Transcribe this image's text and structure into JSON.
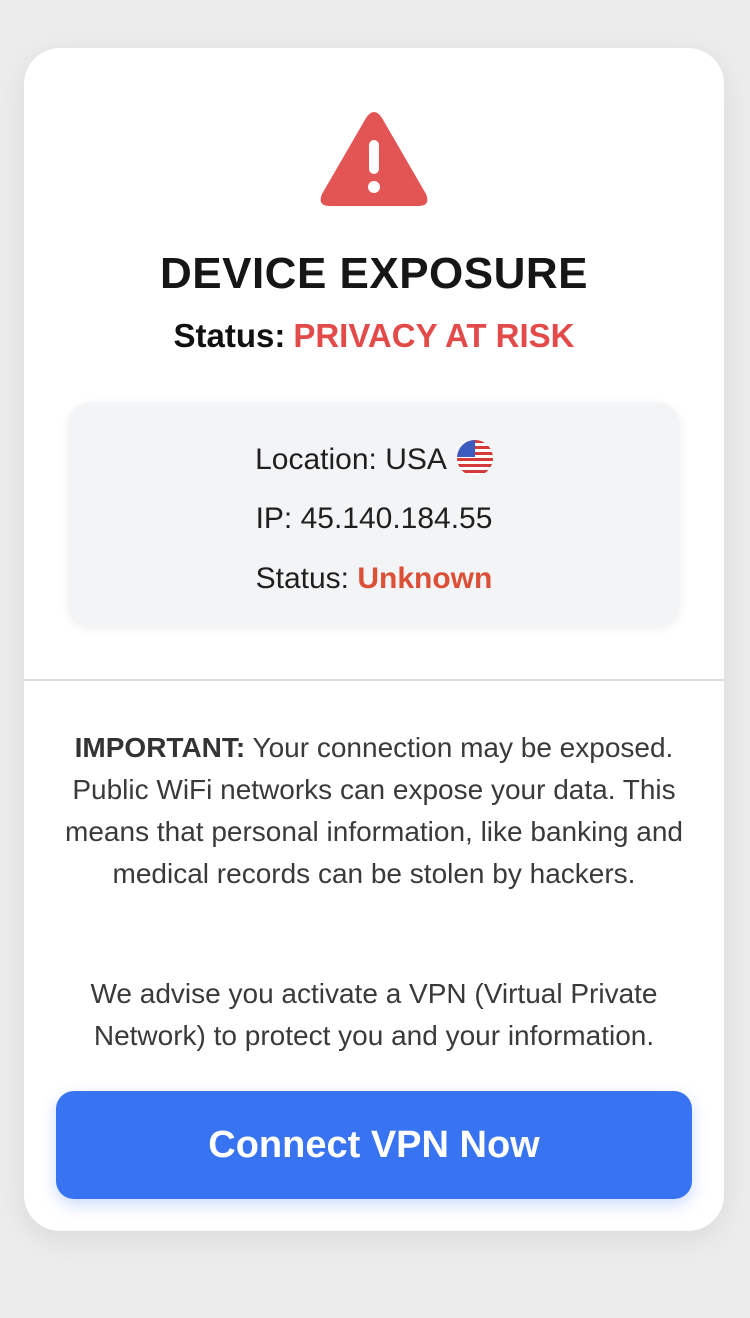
{
  "card": {
    "title": "DEVICE EXPOSURE",
    "status_label": "Status:",
    "status_value": "PRIVACY AT RISK"
  },
  "info": {
    "location_label": "Location: USA",
    "location_flag_icon": "us-flag-icon",
    "ip_label": "IP: 45.140.184.55",
    "status_label": "Status:",
    "status_value": "Unknown"
  },
  "message": {
    "important_lead": "IMPORTANT:",
    "important_text": " Your connection may be exposed. Public WiFi networks can expose your data. This means that personal information, like banking and medical records can be stolen by hackers.",
    "advise_text": "We advise you activate a VPN (Virtual Private Network) to protect you and your information."
  },
  "cta": {
    "label": "Connect VPN Now"
  },
  "colors": {
    "danger": "#e34b4b",
    "warning_value": "#dc5038",
    "button": "#3873f2",
    "background": "#ececec"
  },
  "icons": {
    "alert": "warning-triangle-icon"
  }
}
